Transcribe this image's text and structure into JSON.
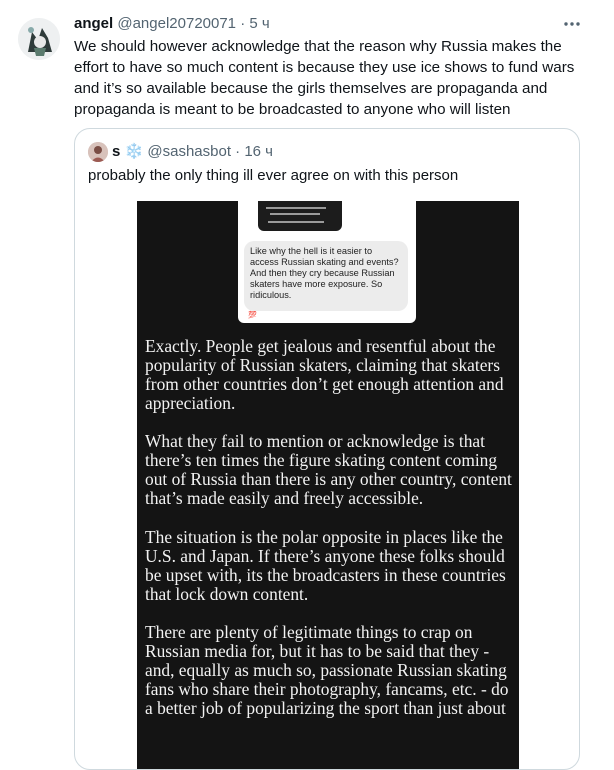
{
  "tweet": {
    "name": "angel",
    "handle": "@angel20720071",
    "separator": "·",
    "time": "5 ч",
    "text": "We should however acknowledge that the reason why Russia makes the effort to have so much content is because they use ice shows to fund wars and it’s so available because the girls themselves are propaganda and propaganda is meant to be broadcasted to anyone who will listen",
    "more_icon": "more-horizontal-icon"
  },
  "quote": {
    "name": "s",
    "badge": "❄️",
    "handle": "@sashasbot",
    "separator": "·",
    "time": "16 ч",
    "text": "probably the only thing ill ever agree on with this person",
    "media": {
      "bubble_text": "Like why the hell is it easier to access Russian skating and events? And then they cry because Russian skaters have more exposure. So ridiculous.",
      "flag_text": "💯",
      "paragraphs": [
        "Exactly. People get jealous and resentful about the popularity of Russian skaters, claiming that skaters from other countries don’t get enough attention and appreciation.",
        "What they fail to mention or acknowledge is that there’s ten times the figure skating content coming out of Russia than there is any other country, content that’s made easily and freely accessible.",
        "The situation is the polar opposite in places like the U.S. and Japan. If there’s anyone these folks should be upset with, its the broadcasters in these countries that lock down content.",
        "There are plenty of legitimate things to crap on Russian media for, but it has to be said that they - and, equally as much so, passionate Russian skating fans who share their photography, fancams, etc. - do a better job of popularizing the sport than just about"
      ]
    }
  }
}
